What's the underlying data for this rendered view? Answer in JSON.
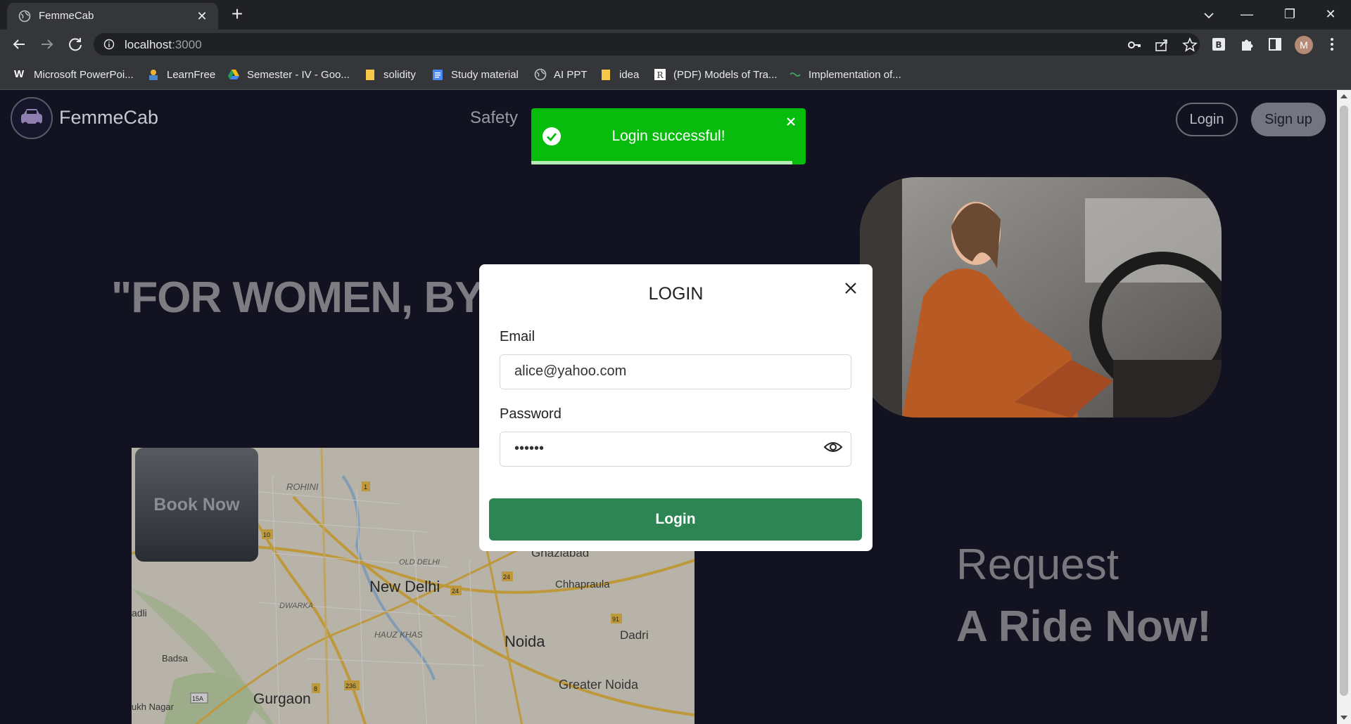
{
  "browser": {
    "tab_title": "FemmeCab",
    "tab_close": "✕",
    "new_tab": "+",
    "window_controls": {
      "minimize": "—",
      "restore": "❐",
      "close": "✕"
    },
    "url_host": "localhost",
    "url_port": ":3000",
    "avatar_letter": "M",
    "bookmarks": [
      {
        "label": "Microsoft PowerPoi...",
        "icon": "word-w-icon"
      },
      {
        "label": "LearnFree",
        "icon": "learnfree-icon"
      },
      {
        "label": "Semester - IV - Goo...",
        "icon": "google-drive-icon"
      },
      {
        "label": "solidity",
        "icon": "folder-icon"
      },
      {
        "label": "Study material",
        "icon": "docs-icon"
      },
      {
        "label": "AI PPT",
        "icon": "globe-icon"
      },
      {
        "label": "idea",
        "icon": "folder-icon"
      },
      {
        "label": "(PDF) Models of Tra...",
        "icon": "researchgate-icon"
      },
      {
        "label": "Implementation of...",
        "icon": "link-icon"
      }
    ]
  },
  "header": {
    "brand": "FemmeCab",
    "nav_safety": "Safety",
    "login_label": "Login",
    "signup_label": "Sign up"
  },
  "hero": {
    "tagline": "\"FOR WOMEN, BY W"
  },
  "book_now": "Book Now",
  "map_labels": {
    "rohini": "ROHINI",
    "old_delhi": "OLD DELHI",
    "new_delhi": "New Delhi",
    "dwarka": "DWARKA",
    "hauz_khas": "HAUZ KHAS",
    "noida": "Noida",
    "ghaziabad": "Ghaziabad",
    "chhapraula": "Chhapraula",
    "dadri": "Dadri",
    "greater_noida": "Greater Noida",
    "gurgaon": "Gurgaon",
    "badsa": "Badsa",
    "adli": "adli",
    "ukh_nagar": "ukh Nagar",
    "r1": "1",
    "r10": "10",
    "r24a": "24",
    "r24b": "24",
    "r91": "91",
    "r8": "8",
    "r236": "236",
    "r15a": "15A"
  },
  "request": {
    "line1": "Request",
    "line2": "A Ride Now!"
  },
  "login_modal": {
    "title": "LOGIN",
    "email_label": "Email",
    "email_value": "alice@yahoo.com",
    "password_label": "Password",
    "password_value": "••••••",
    "submit_label": "Login"
  },
  "toast": {
    "message": "Login successful!",
    "progress": 0.95
  },
  "colors": {
    "page_bg": "#121220",
    "toast_bg": "#07bc0c",
    "submit_bg": "#2e8554"
  }
}
